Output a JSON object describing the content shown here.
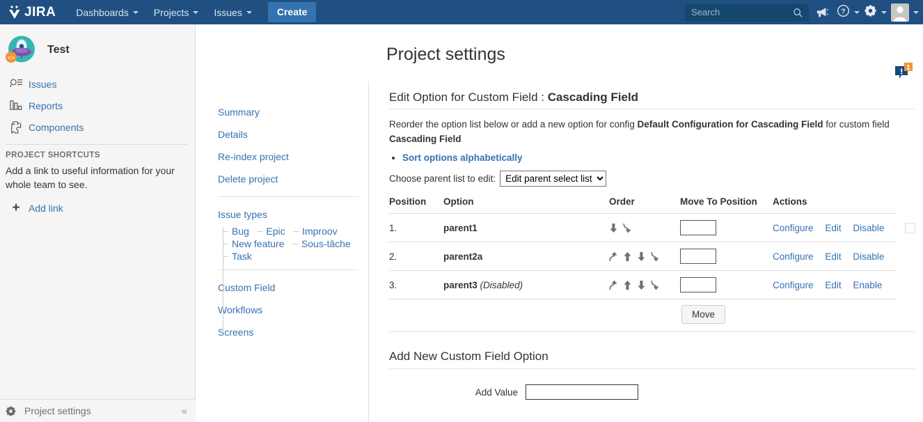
{
  "topnav": {
    "logo_text": "JIRA",
    "links": [
      {
        "label": "Dashboards",
        "has_caret": true
      },
      {
        "label": "Projects",
        "has_caret": true
      },
      {
        "label": "Issues",
        "has_caret": true
      }
    ],
    "create_label": "Create",
    "search_placeholder": "Search",
    "search_value": "",
    "icons": [
      "megaphone-icon",
      "help-icon",
      "settings-gear-icon",
      "user-avatar"
    ]
  },
  "sidebar": {
    "project_name": "Test",
    "items": [
      {
        "label": "Issues",
        "icon": "issues-search-icon"
      },
      {
        "label": "Reports",
        "icon": "reports-bar-chart-icon"
      },
      {
        "label": "Components",
        "icon": "components-puzzle-icon"
      }
    ],
    "shortcuts_heading": "PROJECT SHORTCUTS",
    "shortcuts_text": "Add a link to useful information for your whole team to see.",
    "add_link_label": "Add link",
    "footer_label": "Project settings"
  },
  "midnav": {
    "top_items": [
      "Summary",
      "Details",
      "Re-index project",
      "Delete project"
    ],
    "issue_types_label": "Issue types",
    "issue_types": [
      "Bug",
      "Epic",
      "Improov",
      "New feature",
      "Sous-tâche",
      "Task"
    ],
    "bottom_items": [
      "Custom Field",
      "Workflows",
      "Screens"
    ]
  },
  "page": {
    "title": "Project settings",
    "section_title_prefix": "Edit Option for Custom Field : ",
    "section_title_field": "Cascading Field",
    "desc_part1": "Reorder the option list below or add a new option for config ",
    "desc_config": "Default Configuration for Cascading Field",
    "desc_part2": " for custom field ",
    "desc_field": "Cascading Field",
    "sort_link": "Sort options alphabetically",
    "choose_label": "Choose parent list to edit:",
    "choose_selected": "Edit parent select list",
    "choose_options": [
      "Edit parent select list"
    ]
  },
  "table": {
    "headers": [
      "Position",
      "Option",
      "Order",
      "Move To Position",
      "Actions"
    ],
    "rows": [
      {
        "position": "1.",
        "option": "parent1",
        "status": "",
        "arrows": [
          "down",
          "bottom"
        ],
        "move_value": "",
        "actions": [
          "Configure",
          "Edit",
          "Disable"
        ]
      },
      {
        "position": "2.",
        "option": "parent2a",
        "status": "",
        "arrows": [
          "top",
          "up",
          "down",
          "bottom"
        ],
        "move_value": "",
        "actions": [
          "Configure",
          "Edit",
          "Disable"
        ]
      },
      {
        "position": "3.",
        "option": "parent3",
        "status": "(Disabled)",
        "arrows": [
          "top",
          "up",
          "down",
          "bottom"
        ],
        "move_value": "",
        "actions": [
          "Configure",
          "Edit",
          "Enable"
        ]
      }
    ],
    "move_button": "Move"
  },
  "add_section": {
    "title": "Add New Custom Field Option",
    "label": "Add Value",
    "value": ""
  },
  "colors": {
    "nav_bg": "#205081",
    "create_btn": "#3572b0",
    "link": "#3572b0",
    "sidebar_bg": "#f5f5f5",
    "badge_orange": "#f79232",
    "avatar_teal": "#35b6b4"
  }
}
